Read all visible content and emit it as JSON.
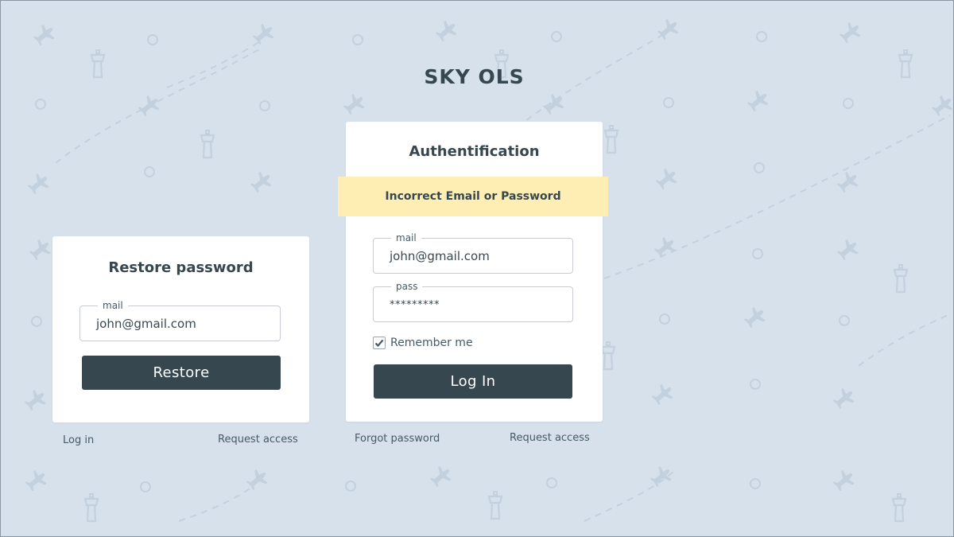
{
  "app": {
    "title": "SKY OLS"
  },
  "restore_card": {
    "title": "Restore password",
    "mail_field": {
      "legend": "mail",
      "value": "john@gmail.com"
    },
    "restore_button": "Restore",
    "links": {
      "login": "Log in",
      "request_access": "Request access"
    }
  },
  "auth_card": {
    "title": "Authentification",
    "error_message": "Incorrect Email or Password",
    "mail_field": {
      "legend": "mail",
      "value": "john@gmail.com"
    },
    "pass_field": {
      "legend": "pass",
      "value": "*********"
    },
    "remember_me": {
      "label": "Remember me",
      "checked": true
    },
    "login_button": "Log In",
    "links": {
      "forgot_password": "Forgot password",
      "request_access": "Request access"
    }
  },
  "icons": {
    "checkmark": "check-icon",
    "background": [
      "plane-icon",
      "control-tower-icon",
      "circle-icon",
      "flight-path"
    ]
  },
  "colors": {
    "background": "#d7e1ec",
    "card": "#ffffff",
    "button": "#37474f",
    "alert": "#ffeeb3",
    "text": "#37474f",
    "pattern": "#c3d0dd"
  }
}
